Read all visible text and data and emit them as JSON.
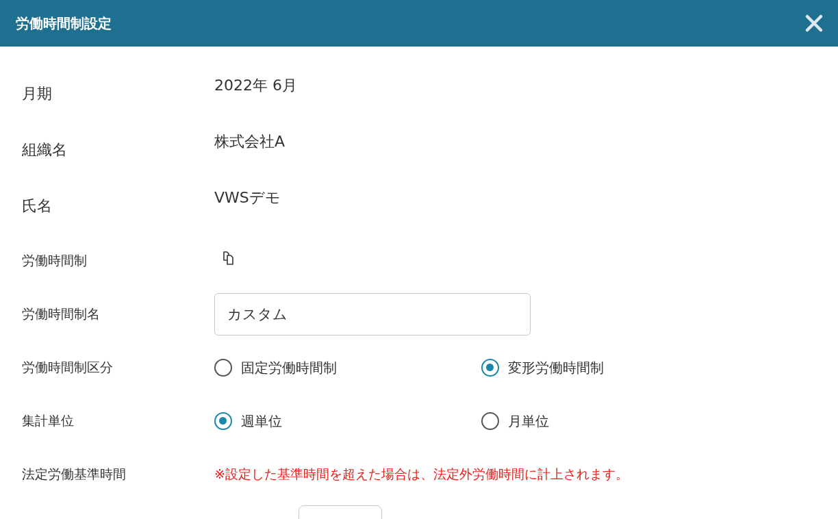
{
  "dialog": {
    "title": "労働時間制設定"
  },
  "fields": [
    {
      "kind": "text",
      "label": "月期",
      "value": "2022年 6月"
    },
    {
      "kind": "text",
      "label": "組織名",
      "value": "株式会社A"
    },
    {
      "kind": "text",
      "label": "氏名",
      "value": "VWSデモ"
    },
    {
      "kind": "icon",
      "label": "労働時間制"
    },
    {
      "kind": "input",
      "label": "労働時間制名",
      "value": "カスタム"
    },
    {
      "kind": "radio",
      "label": "労働時間制区分",
      "options": [
        {
          "label": "固定労働時間制",
          "selected": false
        },
        {
          "label": "変形労働時間制",
          "selected": true
        }
      ]
    },
    {
      "kind": "radio",
      "label": "集計単位",
      "options": [
        {
          "label": "週単位",
          "selected": true
        },
        {
          "label": "月単位",
          "selected": false
        }
      ]
    },
    {
      "kind": "note",
      "label": "法定労働基準時間",
      "note": "※設定した基準時間を超えた場合は、法定外労働時間に計上されます。"
    },
    {
      "kind": "blank_input"
    }
  ]
}
